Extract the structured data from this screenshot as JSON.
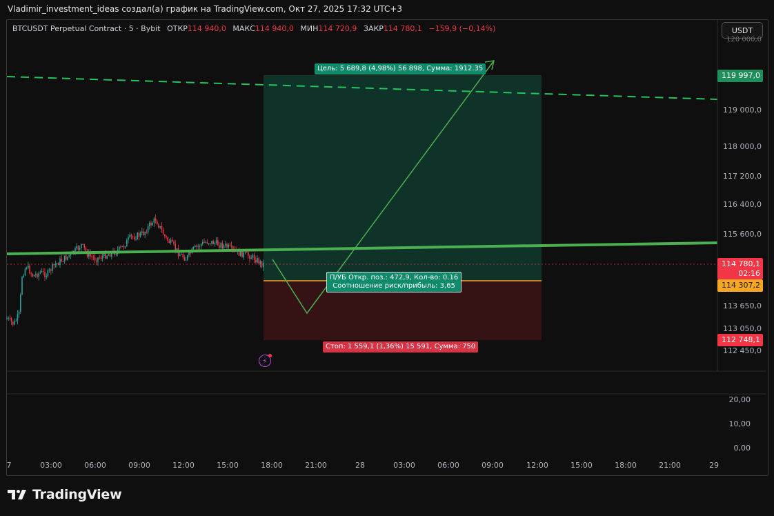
{
  "header": {
    "title": "Vladimir_investment_ideas создал(а) график на TradingView.com, Окт 27, 2025 17:32 UTC+3"
  },
  "legend": {
    "symbol": "BTCUSDT Perpetual Contract · 5 · Bybit",
    "open_label": "ОТКР",
    "open_value": "114 940,0",
    "high_label": "МАКС",
    "high_value": "114 940,0",
    "low_label": "МИН",
    "low_value": "114 720,9",
    "close_label": "ЗАКР",
    "close_value": "114 780,1",
    "change": "−159,9 (−0,14%)"
  },
  "currency_button": "USDT",
  "price_axis": {
    "top_clipped": "120 000,0",
    "labels": [
      "119 000,0",
      "118 000,0",
      "117 200,0",
      "116 400,0",
      "115 600,0",
      "113 650,0",
      "113 050,0",
      "112 450,0"
    ]
  },
  "badges": {
    "target": "119 997,0",
    "last_price": "114 780,1",
    "countdown": "02:16",
    "entry": "114 307,2",
    "stop": "112 748,1"
  },
  "indicator_axis": [
    "20,00",
    "10,00",
    "0,00"
  ],
  "time_axis": [
    "7",
    "03:00",
    "06:00",
    "09:00",
    "12:00",
    "15:00",
    "18:00",
    "21:00",
    "28",
    "03:00",
    "06:00",
    "09:00",
    "12:00",
    "15:00",
    "18:00",
    "21:00",
    "29"
  ],
  "position": {
    "target_label": "Цель: 5 689,8 (4,98%) 56 898, Сумма: 1912.35",
    "pnl_label_line1": "П/УБ Откр. поз.: 472,9, Кол-во: 0.16",
    "pnl_label_line2": "Соотношение риск/прибыль: 3,65",
    "stop_label": "Стоп: 1 559,1 (1,36%) 15 591, Сумма: 750"
  },
  "colors": {
    "background": "#0f0f0f",
    "up": "#26a69a",
    "down": "#f23645",
    "trend": "#4caf50",
    "dashed": "#22c55e",
    "profit_zone": "#0f3a2e",
    "loss_zone": "#3a1416",
    "entry_line": "#f5a623"
  },
  "icons": [
    "tradingview-logo",
    "flash-alert-icon"
  ],
  "brand": "TradingView"
}
